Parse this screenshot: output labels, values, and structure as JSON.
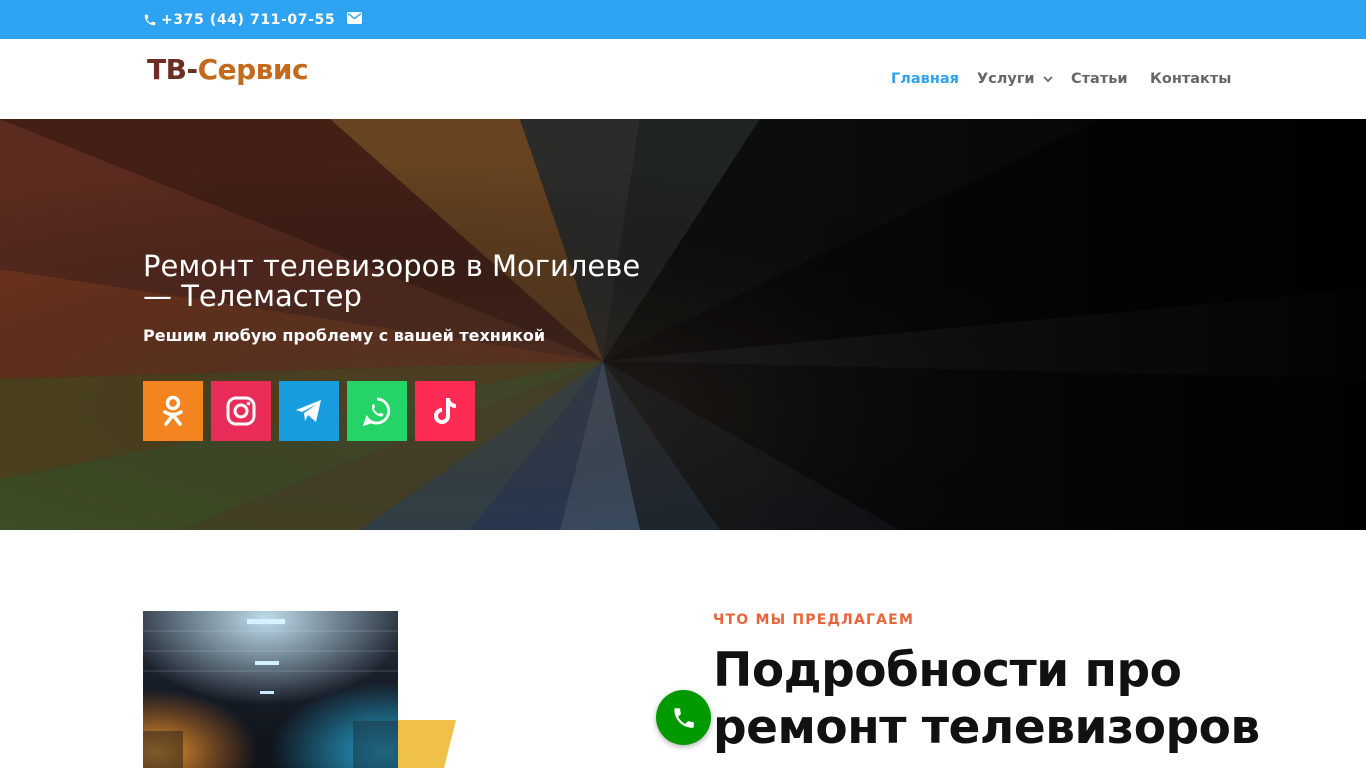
{
  "topbar": {
    "phone": "+375 (44) 711-07-55",
    "phone_icon": "phone-icon",
    "mail_icon": "mail-icon",
    "background": "#2ea3f2"
  },
  "header": {
    "logo_part1": "ТВ-",
    "logo_part2": "Сервис",
    "nav": [
      {
        "label": "Главная",
        "active": true
      },
      {
        "label": "Услуги",
        "has_dropdown": true
      },
      {
        "label": "Статьи"
      },
      {
        "label": "Контакты"
      }
    ],
    "accent": "#2ea3f2"
  },
  "hero": {
    "title": "Ремонт телевизоров в Могилеве — Телемастер",
    "subtitle": "Решим любую проблему с вашей техникой",
    "social": [
      {
        "icon": "odnoklassniki-icon",
        "color": "#f48420"
      },
      {
        "icon": "instagram-icon",
        "color": "#ea2c59"
      },
      {
        "icon": "telegram-icon",
        "color": "#179cde"
      },
      {
        "icon": "whatsapp-icon",
        "color": "#25d366"
      },
      {
        "icon": "tiktok-icon",
        "color": "#fe2c55"
      }
    ]
  },
  "section": {
    "kicker": "ЧТО МЫ ПРЕДЛАГАЕМ",
    "title": "Подробности про ремонт телевизоров",
    "kicker_color": "#e8653a"
  },
  "call_button": {
    "icon": "phone-icon",
    "color": "#009900"
  }
}
